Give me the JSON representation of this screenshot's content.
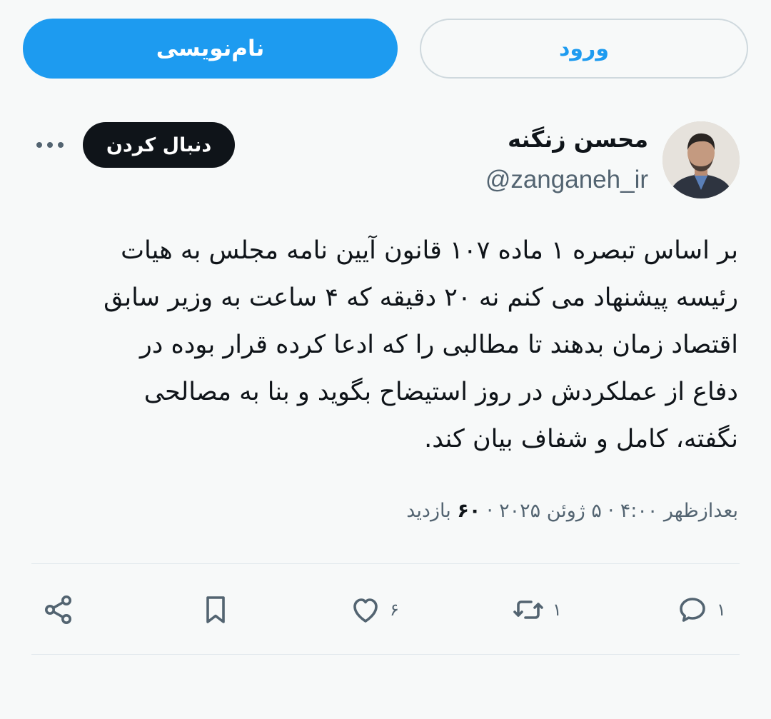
{
  "header": {
    "signup_label": "نام‌نویسی",
    "login_label": "ورود"
  },
  "author": {
    "display_name": "محسن زنگنه",
    "handle": "@zanganeh_ir",
    "follow_label": "دنبال کردن",
    "more_icon": "more-dots-icon"
  },
  "tweet": {
    "lines": [
      "بر اساس تبصره ۱ ماده ۱۰۷ قانون آیین نامه مجلس به هیات",
      "رئیسه پیشنهاد می کنم نه ۲۰ دقیقه که ۴ ساعت به وزیر سابق",
      "اقتصاد زمان بدهند تا مطالبی را که ادعا کرده قرار بوده در",
      "دفاع از عملکردش در روز استیضاح بگوید و بنا به مصالحی",
      "نگفته، کامل و شفاف بیان کند."
    ]
  },
  "meta": {
    "time": "بعدازظهر ۴:۰۰",
    "date": "۵ ژوئن ۲۰۲۵",
    "views_label": "بازدید",
    "views_count": "۶۰",
    "separator": "·"
  },
  "actions": {
    "reply_count": "۱",
    "retweet_count": "۱",
    "like_count": "۶",
    "bookmark_icon": "bookmark-icon",
    "share_icon": "share-icon"
  },
  "colors": {
    "accent": "#1d9bf0",
    "text": "#0f1419",
    "muted": "#536471",
    "background": "#f7f9f9"
  }
}
